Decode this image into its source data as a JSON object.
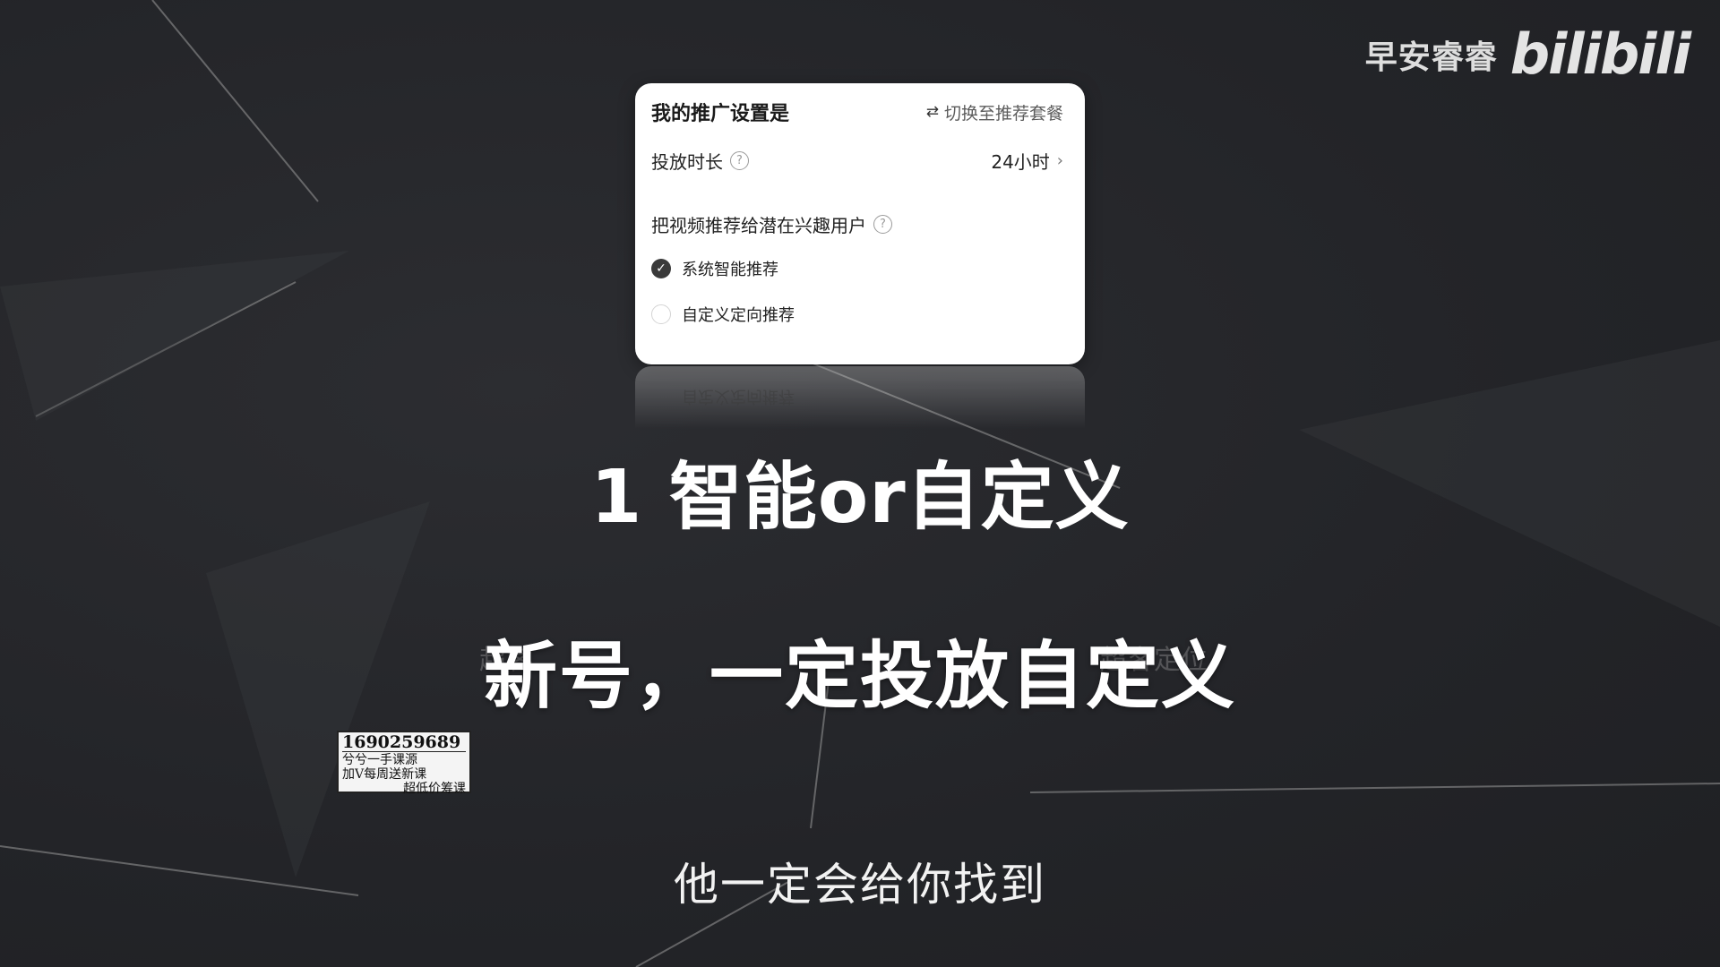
{
  "brand": {
    "name": "早安睿睿",
    "logo": "bilibili"
  },
  "card": {
    "title": "我的推广设置是",
    "switch_icon": "swap-arrows-icon",
    "switch_label": "切换至推荐套餐",
    "duration_label": "投放时长",
    "duration_value": "24小时",
    "audience_label": "把视频推荐给潜在兴趣用户",
    "options": [
      {
        "label": "系统智能推荐",
        "checked": true
      },
      {
        "label": "自定义定向推荐",
        "checked": false
      }
    ]
  },
  "reflection_text": "自定义定向推荐",
  "captions": {
    "heading1": "1 智能or自定义",
    "heading2": "新号，一定投放自定义",
    "faded_left": "超客",
    "faded_right": "超客定位",
    "subtitle": "他一定会给你找到"
  },
  "stamp": {
    "number": "1690259689",
    "line1": "兮兮一手课源",
    "line2": "加V每周送新课",
    "line3": "超低价筹课"
  }
}
